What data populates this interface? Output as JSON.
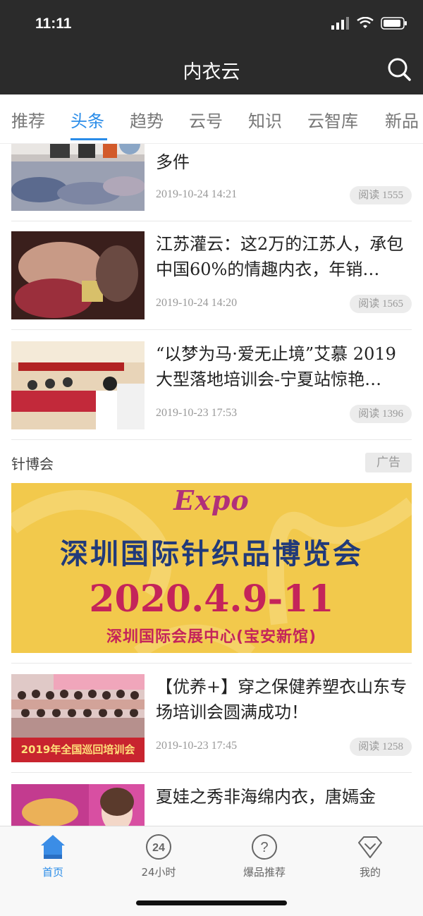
{
  "status": {
    "time": "11:11"
  },
  "header": {
    "title": "内衣云",
    "search_icon": "search-icon"
  },
  "tabs": [
    {
      "label": "推荐",
      "active": false
    },
    {
      "label": "头条",
      "active": true
    },
    {
      "label": "趋势",
      "active": false
    },
    {
      "label": "云号",
      "active": false
    },
    {
      "label": "知识",
      "active": false
    },
    {
      "label": "云智库",
      "active": false
    },
    {
      "label": "新品",
      "active": false
    }
  ],
  "articles": [
    {
      "title": "多件",
      "date": "2019-10-24 14:21",
      "reads": "阅读 1555"
    },
    {
      "title": "江苏灌云：这2万的江苏人，承包中国60%的情趣内衣，年销…",
      "date": "2019-10-24 14:20",
      "reads": "阅读 1565"
    },
    {
      "title": "“以梦为马·爱无止境”艾慕 2019 大型落地培训会-宁夏站惊艳…",
      "date": "2019-10-23 17:53",
      "reads": "阅读 1396"
    },
    {
      "title": "【优养+】穿之保健养塑衣山东专场培训会圆满成功！",
      "date": "2019-10-23 17:45",
      "reads": "阅读 1258"
    },
    {
      "title": "夏娃之秀非海绵内衣，唐嫣金",
      "date": "",
      "reads": ""
    }
  ],
  "ad": {
    "source": "针博会",
    "badge": "广告",
    "logo": "Expo",
    "line1": "深圳国际针织品博览会",
    "line2": "2020.4.9-11",
    "line3": "深圳国际会展中心(宝安新馆)"
  },
  "photo_text": {
    "training_banner": "2019年全国巡回培训会"
  },
  "tabbar": [
    {
      "label": "首页",
      "icon": "home-icon",
      "active": true
    },
    {
      "label": "24小时",
      "icon": "24-hours-icon",
      "active": false
    },
    {
      "label": "爆品推荐",
      "icon": "question-icon",
      "active": false
    },
    {
      "label": "我的",
      "icon": "heart-diamond-icon",
      "active": false
    }
  ],
  "colors": {
    "accent": "#2a8ce8",
    "header_bg": "#2b2b2b",
    "ad_bg": "#f2c94c"
  }
}
